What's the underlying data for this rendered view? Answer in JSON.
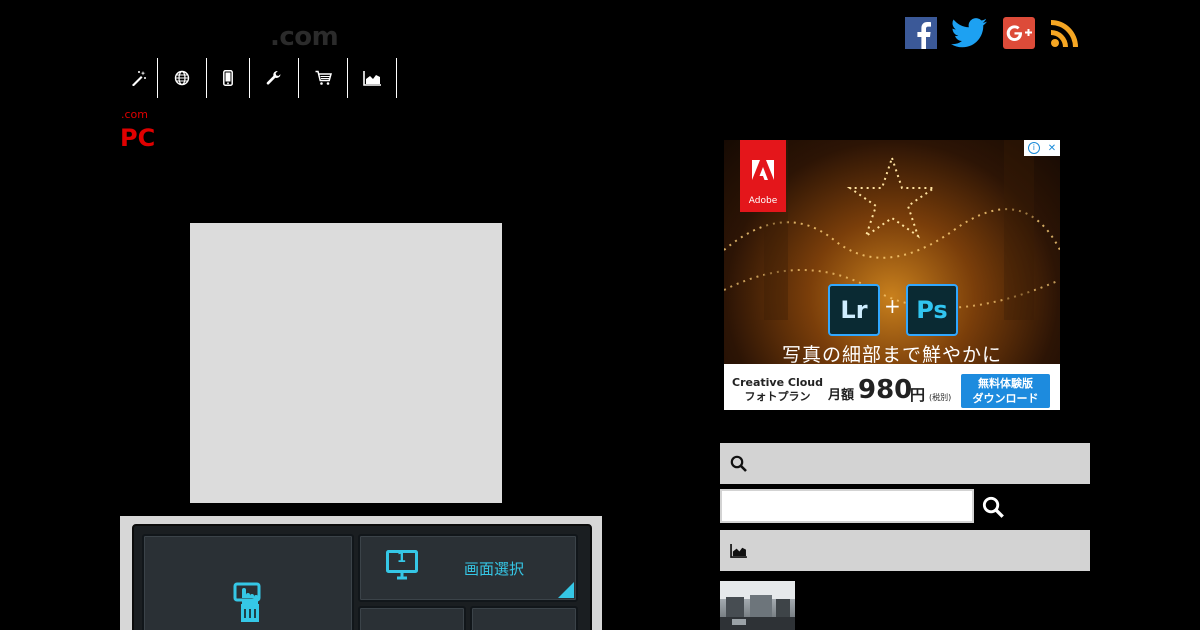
{
  "header": {
    "logo_suffix": ".com",
    "nav": [
      {
        "icon": "magic-wand-icon"
      },
      {
        "icon": "globe-icon"
      },
      {
        "icon": "mobile-phone-icon"
      },
      {
        "icon": "wrench-icon"
      },
      {
        "icon": "shopping-cart-icon"
      },
      {
        "icon": "area-chart-icon"
      }
    ],
    "social": [
      {
        "icon": "facebook-icon",
        "color": "#3b5998"
      },
      {
        "icon": "twitter-icon",
        "color": "#1da1f2"
      },
      {
        "icon": "google-plus-icon",
        "color": "#dd4b39"
      },
      {
        "icon": "rss-icon",
        "color": "#f5a623"
      }
    ]
  },
  "article": {
    "breadcrumb": ".com",
    "title": "PC",
    "title_color": "#e00000"
  },
  "widget": {
    "monitor_number": "1",
    "screen_select_label": "画面選択",
    "accent_color": "#35c7e6"
  },
  "ad": {
    "brand": "Adobe",
    "app_left": "Lr",
    "plus": "+",
    "app_right": "Ps",
    "caption": "写真の細部まで鮮やかに",
    "product_line1": "Creative Cloud",
    "product_line2": "フォトプラン",
    "price_label": "月額",
    "price": "980",
    "price_unit": "円",
    "price_tax": "(税別)",
    "cta_line1": "無料体験版",
    "cta_line2": "ダウンロード",
    "adchoices_info": "i",
    "adchoices_close": "✕"
  },
  "sidebar": {
    "search_section_icon": "search-icon",
    "search_input_value": "",
    "search_button_icon": "search-icon",
    "ranking_section_icon": "area-chart-icon"
  }
}
